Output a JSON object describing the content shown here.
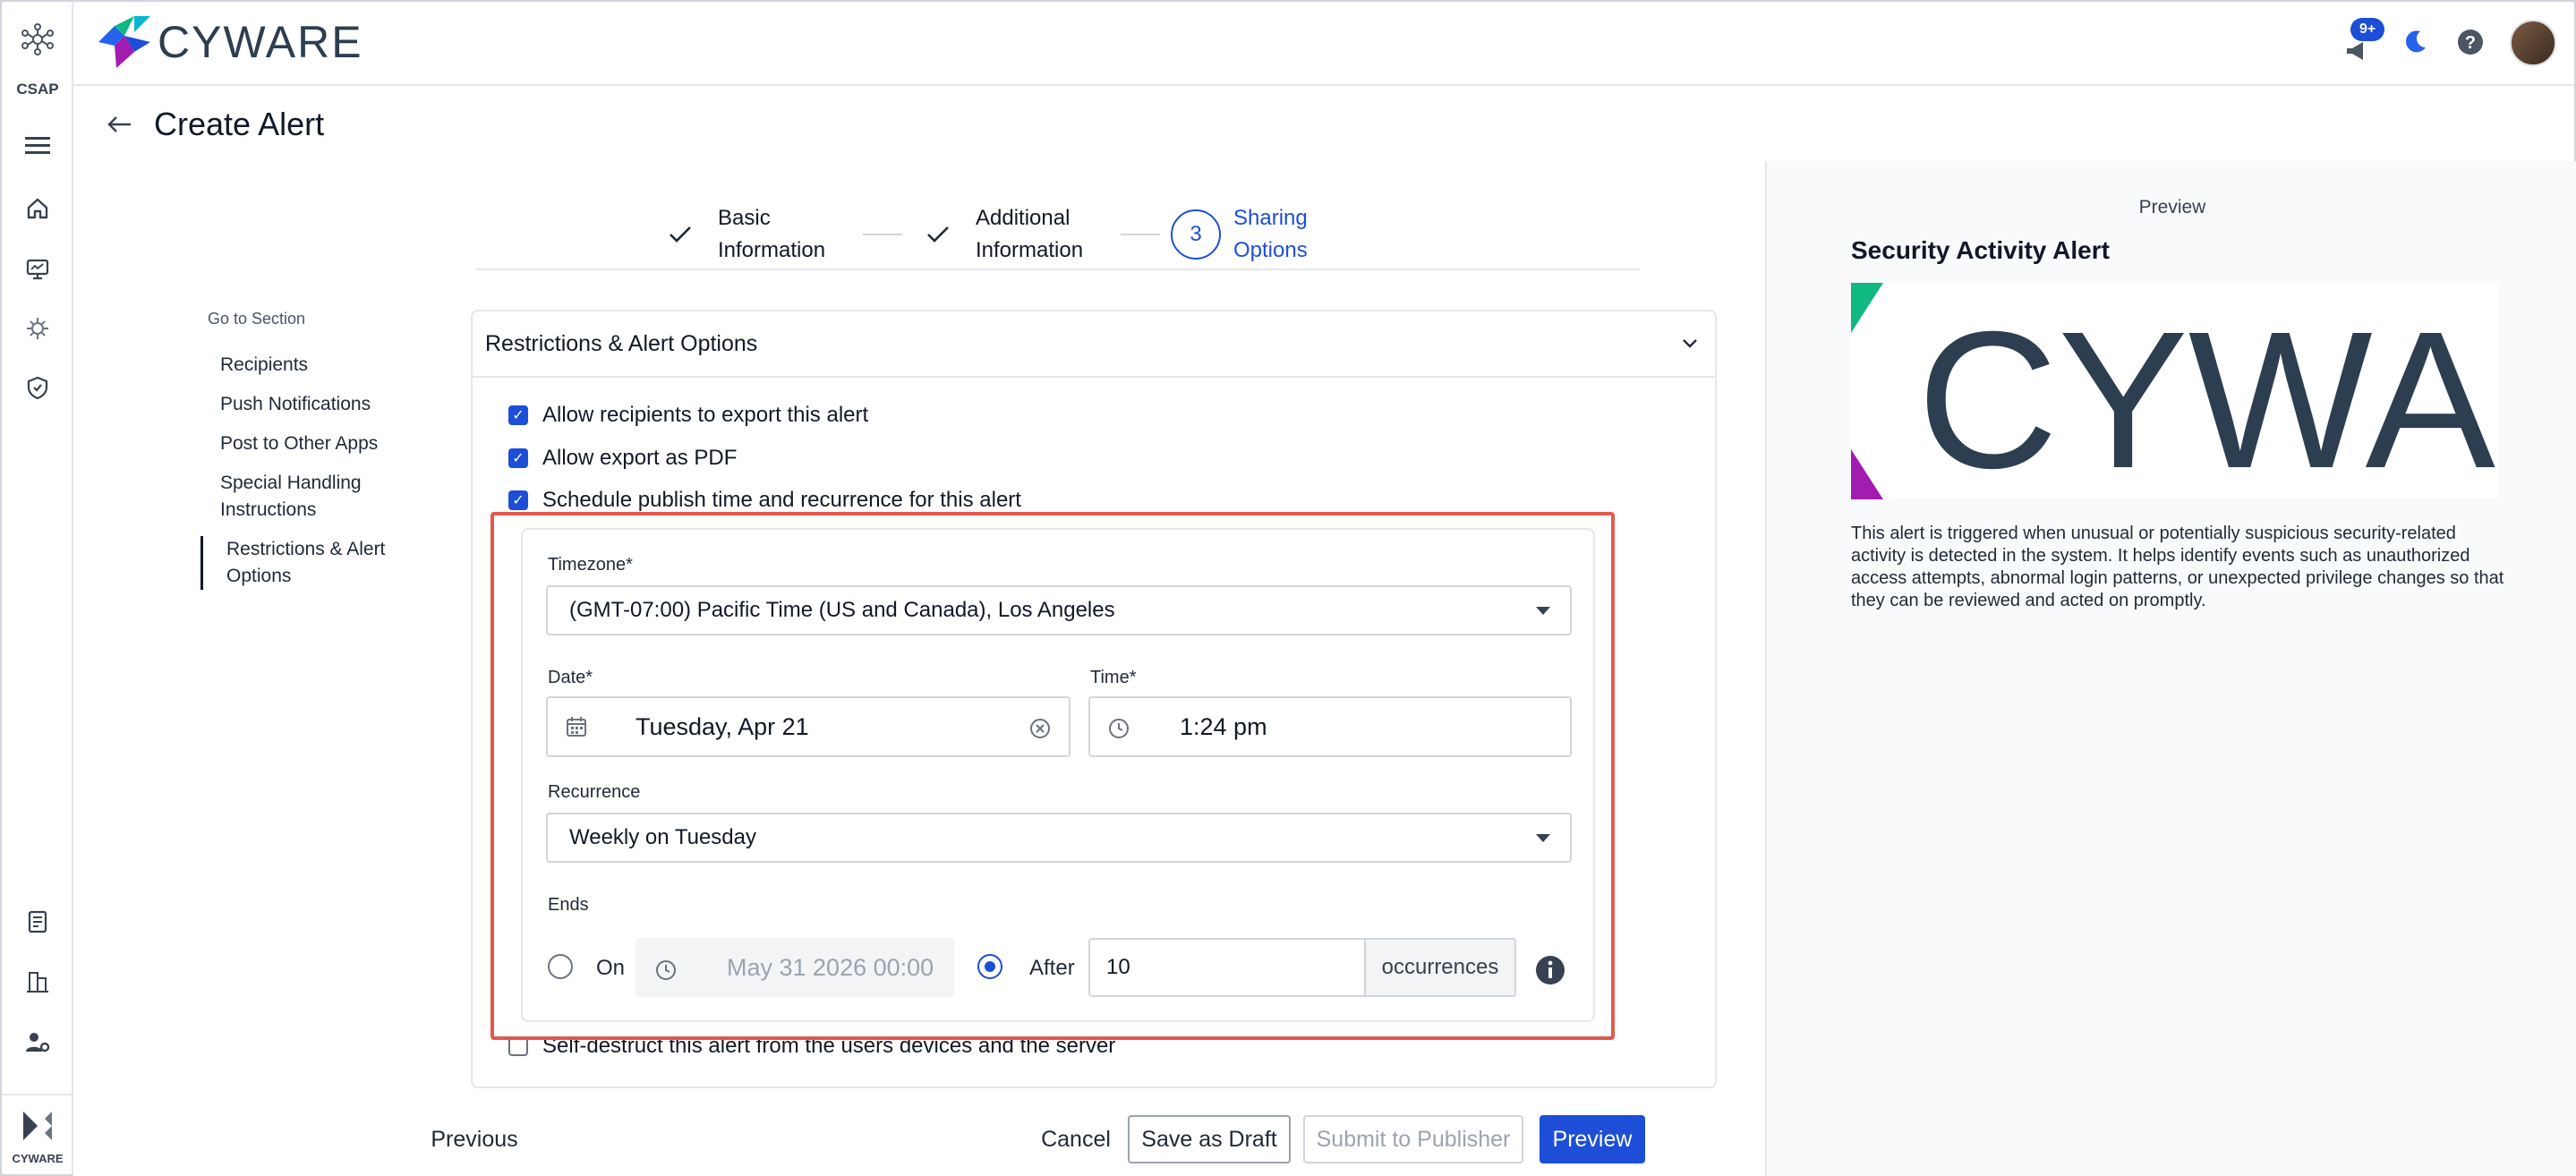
{
  "app": {
    "product": "CSAP",
    "brand": "CYWARE",
    "notification_count": "9+"
  },
  "page": {
    "title": "Create Alert"
  },
  "stepper": [
    {
      "label": "Basic Information",
      "state": "done"
    },
    {
      "label": "Additional Information",
      "state": "done"
    },
    {
      "label": "Sharing Options",
      "number": "3",
      "state": "active"
    }
  ],
  "goto": {
    "header": "Go to Section",
    "items": [
      "Recipients",
      "Push Notifications",
      "Post to Other Apps",
      "Special Handling Instructions",
      "Restrictions & Alert Options"
    ],
    "active": "Restrictions & Alert Options"
  },
  "section": {
    "title": "Restrictions & Alert Options",
    "options": [
      {
        "label": "Allow recipients to export this alert",
        "checked": true
      },
      {
        "label": "Allow export as PDF",
        "checked": true
      },
      {
        "label": "Schedule publish time and recurrence for this alert",
        "checked": true
      },
      {
        "label": "Self-destruct this alert from the users devices and the server",
        "checked": false
      }
    ]
  },
  "schedule": {
    "timezone_label": "Timezone*",
    "timezone_value": "(GMT-07:00) Pacific Time (US and Canada), Los Angeles",
    "date_label": "Date*",
    "date_value": "Tuesday, Apr 21",
    "time_label": "Time*",
    "time_value": "1:24 pm",
    "recurrence_label": "Recurrence",
    "recurrence_value": "Weekly on Tuesday",
    "ends_label": "Ends",
    "ends_on_label": "On",
    "ends_on_value": "May 31 2026 00:00",
    "ends_after_label": "After",
    "ends_after_value": "10",
    "ends_after_unit": "occurrences",
    "ends_selected": "after"
  },
  "footer": {
    "previous": "Previous",
    "cancel": "Cancel",
    "save_draft": "Save as Draft",
    "submit": "Submit to Publisher",
    "preview": "Preview"
  },
  "preview_panel": {
    "label": "Preview",
    "title": "Security Activity Alert",
    "image_text": "CYWAR",
    "description": "This alert is triggered when unusual or potentially suspicious security-related activity is detected in the system. It helps identify events such as unauthorized access attempts, abnormal login patterns, or unexpected privilege changes so that they can be reviewed and acted on promptly."
  },
  "colors": {
    "accent": "#1d4ed8",
    "highlight_border": "#e05a4b",
    "brand_text": "#2d3e50"
  }
}
